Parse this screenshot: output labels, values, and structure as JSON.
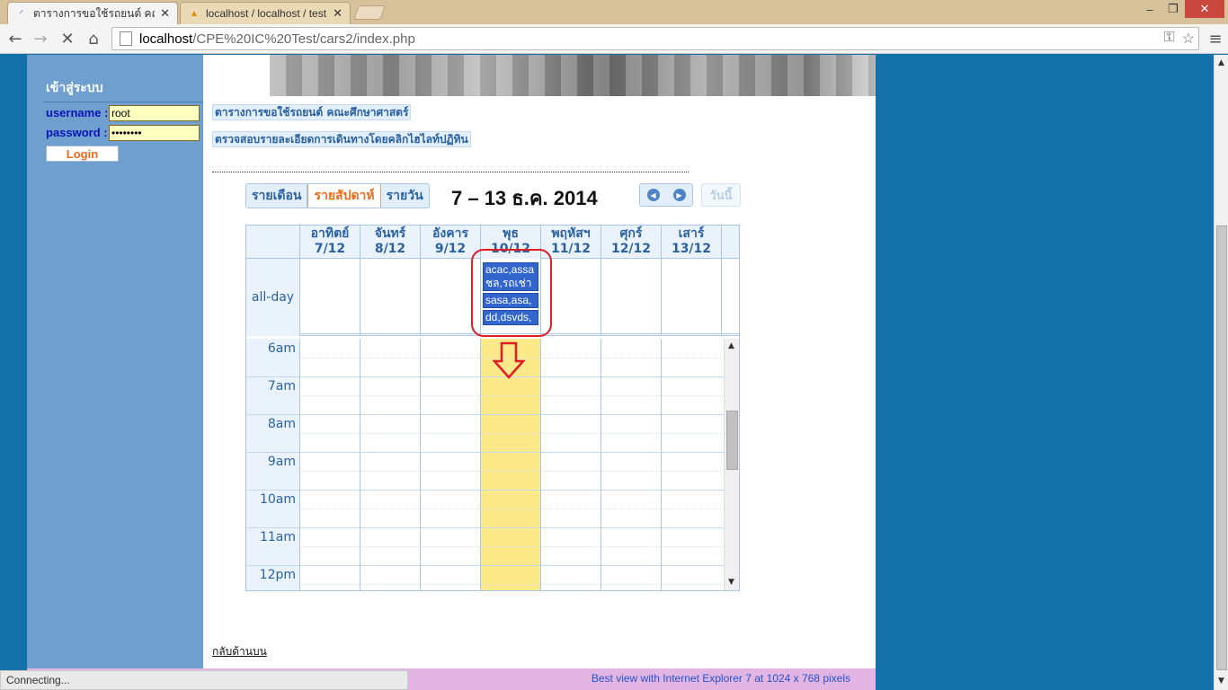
{
  "browser": {
    "tabs": [
      {
        "title": "ตารางการขอใช้รถยนต์ คณะศึก",
        "active": true
      },
      {
        "title": "localhost / localhost / test",
        "active": false
      }
    ],
    "window_controls": {
      "minimize": "–",
      "restore": "❐",
      "close": "✕"
    },
    "url_host": "localhost",
    "url_path": "/CPE%20IC%20Test/cars2/index.php",
    "status_text": "Connecting..."
  },
  "login": {
    "title": "เข้าสู่ระบบ",
    "username_label": "username :",
    "username_value": "root",
    "password_label": "password :",
    "password_value": "••••••••",
    "login_button": "Login"
  },
  "page": {
    "link_schedule": "ตารางการขอใช้รถยนต์ คณะศึกษาศาสตร์",
    "link_details": "ตรวจสอบรายละเอียดการเดินทางโดยคลิกไฮไลท์ปฏิทิน",
    "back_to_top": "กลับด้านบน",
    "footer": "Best view with Internet Explorer 7 at 1024 x 768 pixels"
  },
  "calendar": {
    "views": [
      {
        "label": "รายเดือน",
        "active": false
      },
      {
        "label": "รายสัปดาห์",
        "active": true
      },
      {
        "label": "รายวัน",
        "active": false
      }
    ],
    "title": "7 – 13 ธ.ค. 2014",
    "today_button": "วันนี้",
    "days": [
      {
        "name": "อาทิตย์",
        "date": "7/12"
      },
      {
        "name": "จันทร์",
        "date": "8/12"
      },
      {
        "name": "อังคาร",
        "date": "9/12"
      },
      {
        "name": "พุธ",
        "date": "10/12",
        "today": true
      },
      {
        "name": "พฤหัสฯ",
        "date": "11/12"
      },
      {
        "name": "ศุกร์",
        "date": "12/12"
      },
      {
        "name": "เสาร์",
        "date": "13/12"
      }
    ],
    "allday_label": "all-day",
    "events": [
      {
        "line1": "acac,assa",
        "line2": "ชล,รถเช่า"
      },
      {
        "line1": "sasa,asa,",
        "line2": ""
      },
      {
        "line1": "dd,dsvds,",
        "line2": ""
      }
    ],
    "times": [
      "6am",
      "7am",
      "8am",
      "9am",
      "10am",
      "11am",
      "12pm"
    ],
    "colors": {
      "header_text": "#2a61a0",
      "event_bg": "#3366cc",
      "today_bg": "#fbe98a",
      "highlight": "#e21b24"
    }
  }
}
